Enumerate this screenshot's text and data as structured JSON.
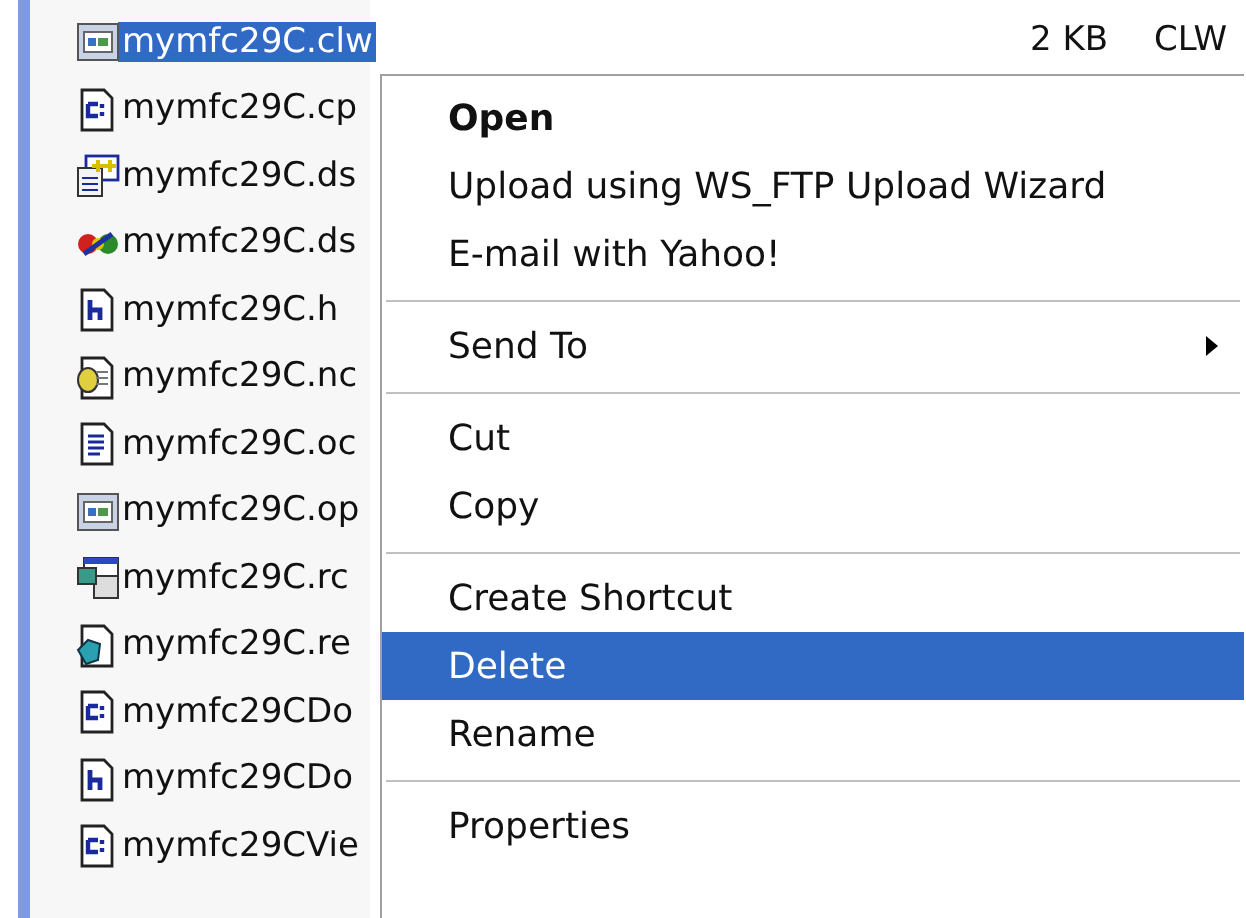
{
  "files": [
    {
      "name": "mymfc29C.clw",
      "kind": "dialog",
      "selected": true,
      "size": "2 KB",
      "type": "CLW"
    },
    {
      "name": "mymfc29C.cp",
      "kind": "cpp",
      "selected": false
    },
    {
      "name": "mymfc29C.ds",
      "kind": "project",
      "selected": false
    },
    {
      "name": "mymfc29C.ds",
      "kind": "workspace",
      "selected": false
    },
    {
      "name": "mymfc29C.h",
      "kind": "header",
      "selected": false
    },
    {
      "name": "mymfc29C.nc",
      "kind": "database",
      "selected": false
    },
    {
      "name": "mymfc29C.oc",
      "kind": "text",
      "selected": false
    },
    {
      "name": "mymfc29C.op",
      "kind": "dialog",
      "selected": false
    },
    {
      "name": "mymfc29C.rc",
      "kind": "resource",
      "selected": false
    },
    {
      "name": "mymfc29C.re",
      "kind": "registry",
      "selected": false
    },
    {
      "name": "mymfc29CDo",
      "kind": "cpp",
      "selected": false
    },
    {
      "name": "mymfc29CDo",
      "kind": "header",
      "selected": false
    },
    {
      "name": "mymfc29CVie",
      "kind": "cpp",
      "selected": false
    }
  ],
  "context_menu": [
    {
      "kind": "item",
      "label": "Open",
      "default": true,
      "selected": false
    },
    {
      "kind": "item",
      "label": "Upload using WS_FTP Upload Wizard",
      "selected": false
    },
    {
      "kind": "item",
      "label": "E-mail with Yahoo!",
      "selected": false
    },
    {
      "kind": "separator"
    },
    {
      "kind": "item",
      "label": "Send To",
      "submenu": true,
      "selected": false
    },
    {
      "kind": "separator"
    },
    {
      "kind": "item",
      "label": "Cut",
      "selected": false
    },
    {
      "kind": "item",
      "label": "Copy",
      "selected": false
    },
    {
      "kind": "separator"
    },
    {
      "kind": "item",
      "label": "Create Shortcut",
      "selected": false
    },
    {
      "kind": "item",
      "label": "Delete",
      "selected": true
    },
    {
      "kind": "item",
      "label": "Rename",
      "selected": false
    },
    {
      "kind": "separator"
    },
    {
      "kind": "item",
      "label": "Properties",
      "selected": false
    }
  ]
}
